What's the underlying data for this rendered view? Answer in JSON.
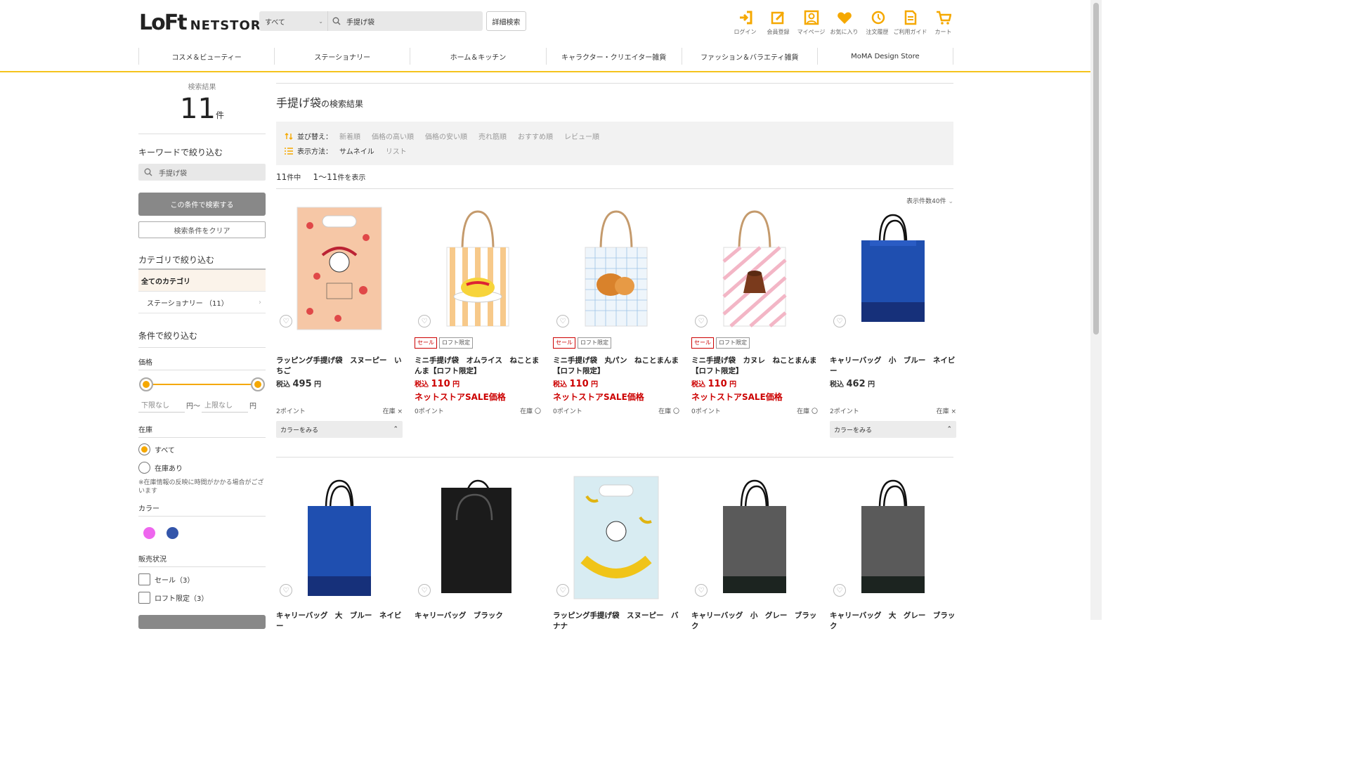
{
  "header": {
    "logo_loft": "LoFt",
    "logo_netstore": "NETSTORE",
    "search_category": "すべて",
    "search_value": "手提げ袋",
    "advanced_search": "詳細検索",
    "icons": [
      {
        "name": "login-icon",
        "label": "ログイン"
      },
      {
        "name": "register-icon",
        "label": "会員登録"
      },
      {
        "name": "mypage-icon",
        "label": "マイページ"
      },
      {
        "name": "favorite-icon",
        "label": "お気に入り"
      },
      {
        "name": "history-icon",
        "label": "注文履歴"
      },
      {
        "name": "guide-icon",
        "label": "ご利用ガイド"
      },
      {
        "name": "cart-icon",
        "label": "カート"
      }
    ],
    "accent_color": "#f5a800"
  },
  "nav": [
    "コスメ＆ビューティー",
    "ステーショナリー",
    "ホーム＆キッチン",
    "キャラクター・クリエイター雑貨",
    "ファッション＆バラエティ雑貨",
    "MoMA Design Store"
  ],
  "sidebar": {
    "result_label": "検索結果",
    "result_count": "11",
    "result_unit": "件",
    "keyword_heading": "キーワードで絞り込む",
    "keyword_value": "手提げ袋",
    "search_button": "この条件で検索する",
    "clear_button": "検索条件をクリア",
    "category_heading": "カテゴリで絞り込む",
    "category_all": "全てのカテゴリ",
    "category_sub": "ステーショナリー （11）",
    "condition_heading": "条件で絞り込む",
    "price_heading": "価格",
    "price_min_placeholder": "下限なし",
    "price_max_placeholder": "上限なし",
    "yen": "円",
    "yen_tilde": "円～",
    "stock_heading": "在庫",
    "stock_all": "すべて",
    "stock_in": "在庫あり",
    "stock_note": "※在庫情報の反映に時間がかかる場合がございます",
    "color_heading": "カラー",
    "colors": [
      "#ee66ee",
      "#3355aa"
    ],
    "sale_heading": "販売状況",
    "sale_option": "セール（3）",
    "loft_option": "ロフト限定（3）"
  },
  "main": {
    "title_keyword": "手提げ袋",
    "title_suffix": "の検索結果",
    "sort_label": "並び替え：",
    "sort_options": [
      "新着順",
      "価格の高い順",
      "価格の安い順",
      "売れ筋順",
      "おすすめ順",
      "レビュー順"
    ],
    "view_label": "表示方法：",
    "view_thumb": "サムネイル",
    "view_list": "リスト",
    "count_total": "11",
    "count_total_suffix": "件中",
    "count_range": "1～11",
    "count_range_suffix": "件を表示",
    "per_page": "表示件数40件"
  },
  "products_row1": [
    {
      "name": "ラッピング手提げ袋　スヌーピー　いちご",
      "tax": "税込",
      "price": "495",
      "yen": "円",
      "sale": false,
      "loft": false,
      "sale_text": "",
      "points": "2ポイント",
      "stock": "在庫 ×",
      "color_btn": "カラーをみる"
    },
    {
      "name": "ミニ手提げ袋　オムライス　ねことまんま【ロフト限定】",
      "tax": "税込",
      "price": "110",
      "yen": "円",
      "sale": true,
      "loft": true,
      "sale_text": "ネットストアSALE価格",
      "points": "0ポイント",
      "stock": "在庫 〇",
      "color_btn": ""
    },
    {
      "name": "ミニ手提げ袋　丸パン　ねことまんま【ロフト限定】",
      "tax": "税込",
      "price": "110",
      "yen": "円",
      "sale": true,
      "loft": true,
      "sale_text": "ネットストアSALE価格",
      "points": "0ポイント",
      "stock": "在庫 〇",
      "color_btn": ""
    },
    {
      "name": "ミニ手提げ袋　カヌレ　ねことまんま【ロフト限定】",
      "tax": "税込",
      "price": "110",
      "yen": "円",
      "sale": true,
      "loft": true,
      "sale_text": "ネットストアSALE価格",
      "points": "0ポイント",
      "stock": "在庫 〇",
      "color_btn": ""
    },
    {
      "name": "キャリーバッグ　小　ブルー　ネイビー",
      "tax": "税込",
      "price": "462",
      "yen": "円",
      "sale": false,
      "loft": false,
      "sale_text": "",
      "points": "2ポイント",
      "stock": "在庫 ×",
      "color_btn": "カラーをみる"
    }
  ],
  "products_row2": [
    {
      "name": "キャリーバッグ　大　ブルー　ネイビー"
    },
    {
      "name": "キャリーバッグ　ブラック"
    },
    {
      "name": "ラッピング手提げ袋　スヌーピー　バナナ"
    },
    {
      "name": "キャリーバッグ　小　グレー　ブラック"
    },
    {
      "name": "キャリーバッグ　大　グレー　ブラック"
    }
  ],
  "tags": {
    "sale": "セール",
    "loft": "ロフト限定"
  }
}
